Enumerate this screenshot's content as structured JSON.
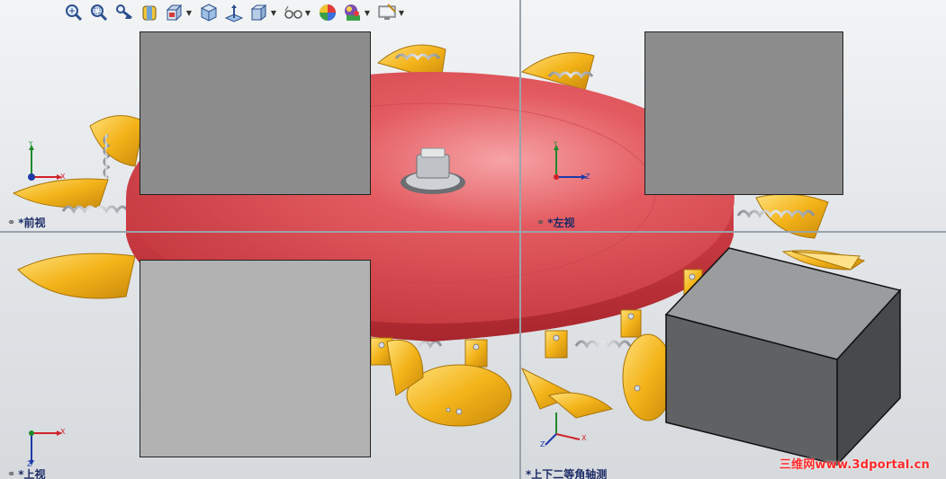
{
  "toolbar": {
    "buttons": [
      {
        "icon": "zoom-to-fit-icon"
      },
      {
        "icon": "zoom-to-area-icon"
      },
      {
        "icon": "previous-view-icon"
      },
      {
        "icon": "section-view-icon"
      },
      {
        "icon": "view-orientation-icon",
        "dropdown": true
      },
      {
        "icon": "display-style-icon"
      },
      {
        "icon": "normal-to-icon"
      },
      {
        "icon": "hide-show-items-icon",
        "dropdown": true
      },
      {
        "icon": "view-settings-icon",
        "dropdown": true
      },
      {
        "icon": "appearance-icon"
      },
      {
        "icon": "scene-icon",
        "dropdown": true
      },
      {
        "icon": "display-pane-icon",
        "dropdown": true
      }
    ]
  },
  "viewports": {
    "front": {
      "label": "*前视"
    },
    "left": {
      "label": "*左视"
    },
    "top": {
      "label": "*上视"
    },
    "iso": {
      "label": "*上下二等角轴测"
    }
  },
  "triad_labels": {
    "x": "X",
    "y": "Y",
    "z": "Z"
  },
  "watermark": "三维网www.3dportal.cn",
  "colors": {
    "disc": "#d8414a",
    "flap": "#f0b21e",
    "spring": "#b8bcc0",
    "cube_front": "#5f6163",
    "cube_top": "#9a9c9e",
    "cube_side": "#47494b"
  }
}
